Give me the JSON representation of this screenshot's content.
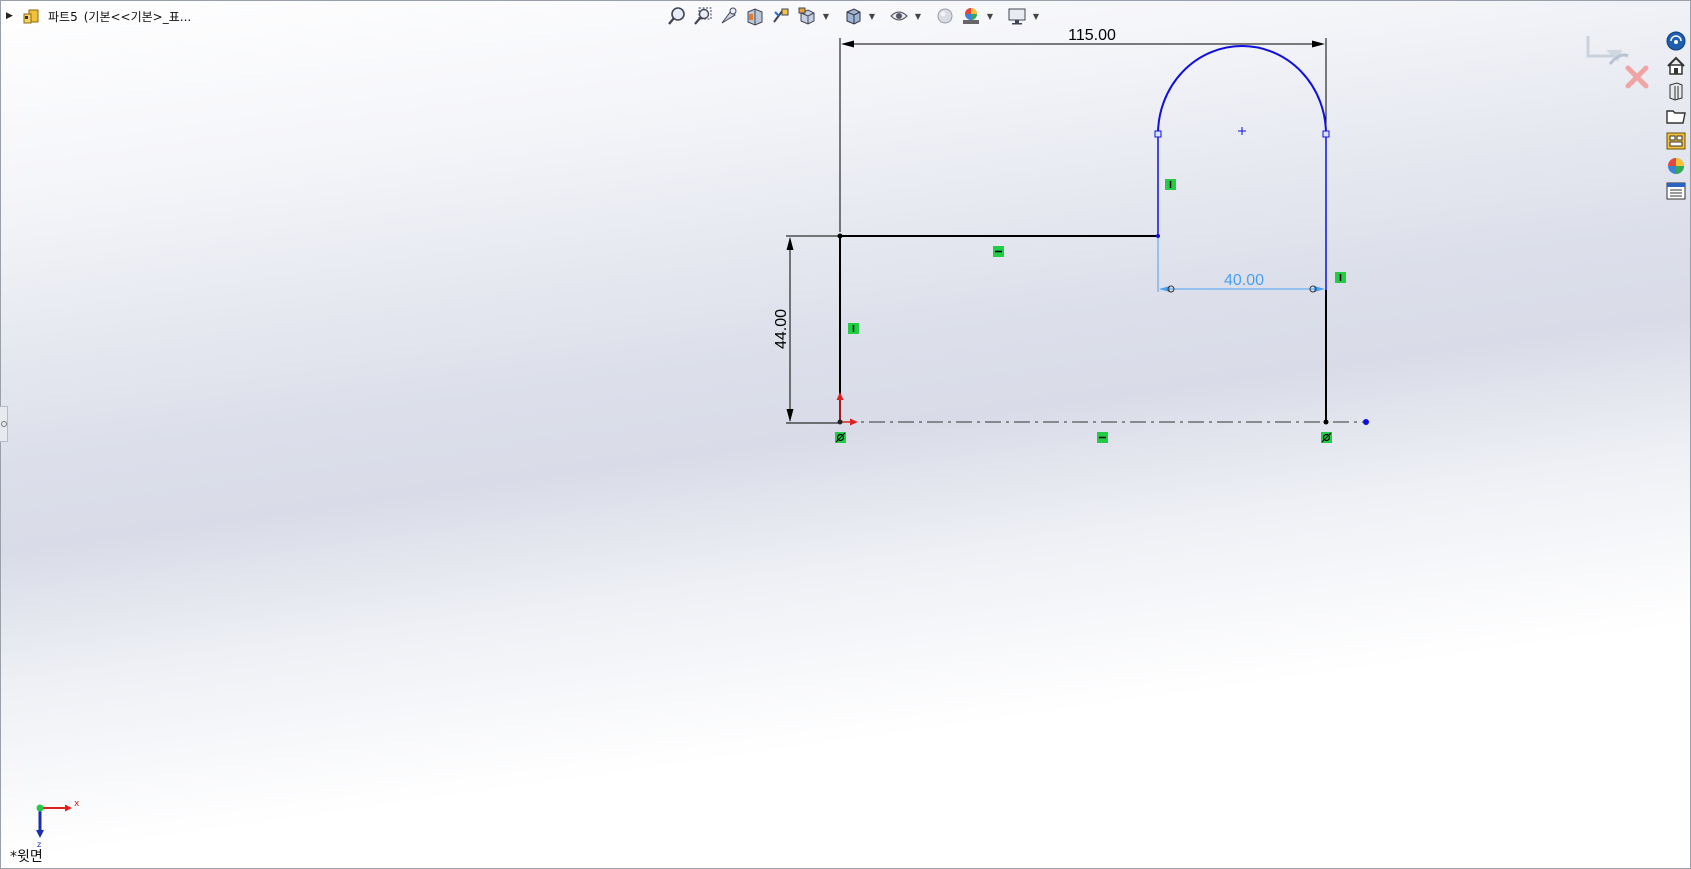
{
  "document": {
    "part_name": "파트5",
    "config_label": "(기본<<기본>_표..."
  },
  "toolbar": {
    "icons": [
      "zoom-to-fit-icon",
      "zoom-to-area-icon",
      "previous-view-icon",
      "section-view-icon",
      "dynamic-annotation-icon",
      "view-orientation-icon",
      "display-style-icon",
      "hide-show-items-icon",
      "edit-appearance-icon",
      "apply-scene-icon",
      "view-settings-icon"
    ]
  },
  "confirmation_corner": {
    "icons": [
      "exit-sketch-icon",
      "cancel-sketch-icon"
    ]
  },
  "task_pane": {
    "icons": [
      "solidworks-resources-icon",
      "design-library-icon",
      "file-explorer-icon",
      "view-palette-icon",
      "appearances-icon",
      "custom-properties-icon"
    ]
  },
  "sketch": {
    "dimensions": {
      "width": "115.00",
      "height": "44.00",
      "slot_width": "40.00"
    },
    "colors": {
      "defined": "#000000",
      "underdefined": "#1010dd",
      "selected_dim": "#4aa0f0",
      "relation": "#22cc44",
      "origin": "#dd2222"
    }
  },
  "view": {
    "orientation_name": "*윗면",
    "triad_x": "x",
    "triad_z": "z"
  }
}
